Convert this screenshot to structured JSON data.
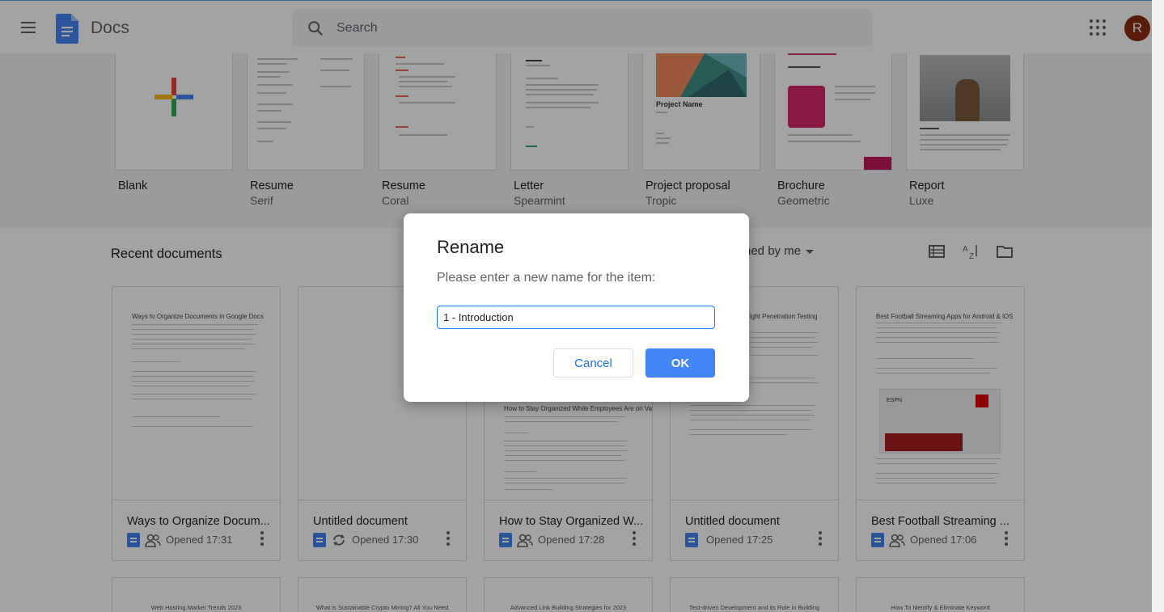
{
  "header": {
    "app_title": "Docs",
    "search_placeholder": "Search",
    "avatar_initial": "R"
  },
  "templates": [
    {
      "name": "Blank",
      "subtitle": ""
    },
    {
      "name": "Resume",
      "subtitle": "Serif"
    },
    {
      "name": "Resume",
      "subtitle": "Coral"
    },
    {
      "name": "Letter",
      "subtitle": "Spearmint"
    },
    {
      "name": "Project proposal",
      "subtitle": "Tropic"
    },
    {
      "name": "Brochure",
      "subtitle": "Geometric"
    },
    {
      "name": "Report",
      "subtitle": "Luxe"
    }
  ],
  "recent": {
    "title": "Recent documents",
    "owner_filter": "ned by me",
    "docs": [
      {
        "title": "Ways to Organize Docum...",
        "thumb_title": "Ways to Organize Documents in Google Docs",
        "opened": "Opened 17:31",
        "icon": "shared-icon"
      },
      {
        "title": "Untitled document",
        "thumb_title": "",
        "opened": "Opened 17:30",
        "icon": "sync-icon"
      },
      {
        "title": "How to Stay Organized W...",
        "thumb_title": "How to Stay Organized While Employees Are on Vacation?",
        "opened": "Opened 17:28",
        "icon": "shared-icon"
      },
      {
        "title": "Untitled document",
        "thumb_title": "ight Penetration Testing",
        "opened": "Opened 17:25",
        "icon": ""
      },
      {
        "title": "Best Football Streaming ...",
        "thumb_title": "Best Football Streaming Apps for Android & iOS",
        "opened": "Opened 17:06",
        "icon": "shared-icon"
      }
    ],
    "more_docs": [
      {
        "thumb_title": "Web Hosting Market Trends 2023"
      },
      {
        "thumb_title": "What is Sustainable Crypto Mining? All You Need"
      },
      {
        "thumb_title": "Advanced Link Building Strategies for 2023"
      },
      {
        "thumb_title": "Test-driven Development and its Role in Building"
      },
      {
        "thumb_title": "How To Identify & Eliminate Keyword"
      }
    ]
  },
  "dialog": {
    "title": "Rename",
    "message": "Please enter a new name for the item:",
    "value": "1 - Introduction",
    "cancel_label": "Cancel",
    "ok_label": "OK"
  },
  "colors": {
    "accent": "#1a73e8",
    "ok_button": "#4285f4",
    "avatar": "#8b2c0f"
  }
}
